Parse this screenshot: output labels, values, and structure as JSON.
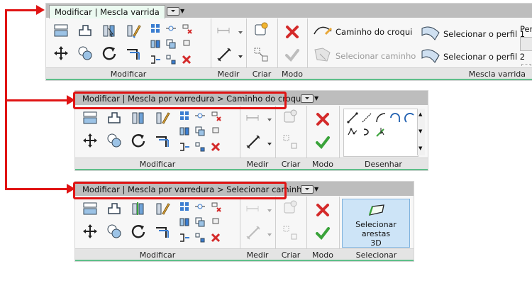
{
  "ribbons": [
    {
      "tab": "Modificar | Mescla varrida",
      "panels": {
        "modify": "Modificar",
        "measure": "Medir",
        "create": "Criar",
        "mode": "Modo",
        "sweep": "Mescla varrida"
      },
      "sweep_buttons": {
        "sketch_path": "Caminho do croqui",
        "pick_path": "Selecionar caminho",
        "profile1": "Selecionar o perfil 1",
        "profile2": "Selecionar o perfil 2",
        "per": "Per"
      }
    },
    {
      "tab": "Modificar | Mescla por varredura > Caminho do croqui",
      "panels": {
        "modify": "Modificar",
        "measure": "Medir",
        "create": "Criar",
        "mode": "Modo",
        "draw": "Desenhar"
      }
    },
    {
      "tab": "Modificar | Mescla por varredura > Selecionar caminho",
      "panels": {
        "modify": "Modificar",
        "measure": "Medir",
        "create": "Criar",
        "mode": "Modo",
        "select": "Selecionar"
      },
      "select_button": {
        "line1": "Selecionar arestas",
        "line2": "3D"
      }
    }
  ],
  "colors": {
    "highlight": "#e01414",
    "tab_active": "#ecfaf1",
    "cancel": "#d42a2a",
    "finish": "#3aa33a"
  }
}
